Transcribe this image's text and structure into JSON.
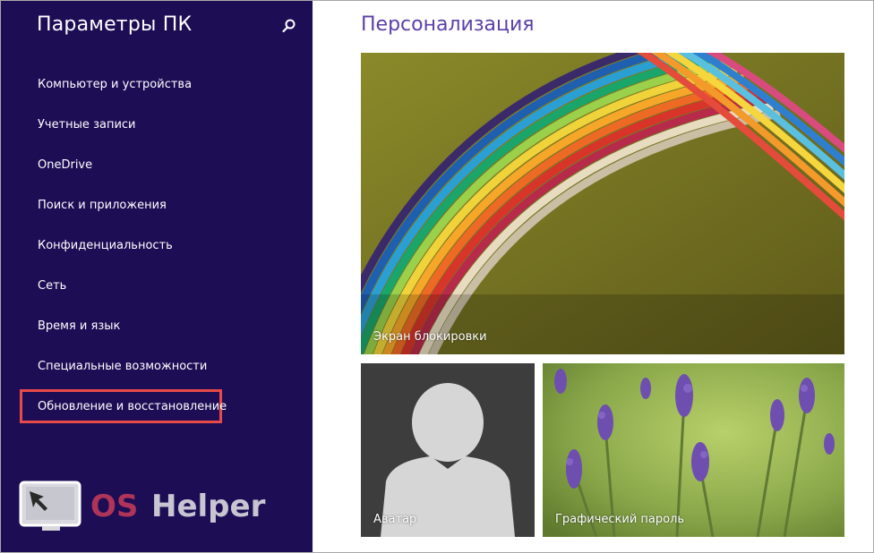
{
  "sidebar": {
    "title": "Параметры ПК",
    "items": [
      {
        "label": "Компьютер и устройства"
      },
      {
        "label": "Учетные записи"
      },
      {
        "label": "OneDrive"
      },
      {
        "label": "Поиск и приложения"
      },
      {
        "label": "Конфиденциальность"
      },
      {
        "label": "Сеть"
      },
      {
        "label": "Время и язык"
      },
      {
        "label": "Специальные возможности"
      },
      {
        "label": "Обновление и восстановление",
        "highlighted": true
      }
    ]
  },
  "watermark": {
    "text": "OS Helper"
  },
  "main": {
    "title": "Персонализация",
    "tiles": [
      {
        "label": "Экран блокировки"
      },
      {
        "label": "Аватар"
      },
      {
        "label": "Графический пароль"
      }
    ]
  },
  "colors": {
    "sidebar_bg": "#1c0d55",
    "accent": "#5b3fa9",
    "highlight": "#e84a4a"
  }
}
